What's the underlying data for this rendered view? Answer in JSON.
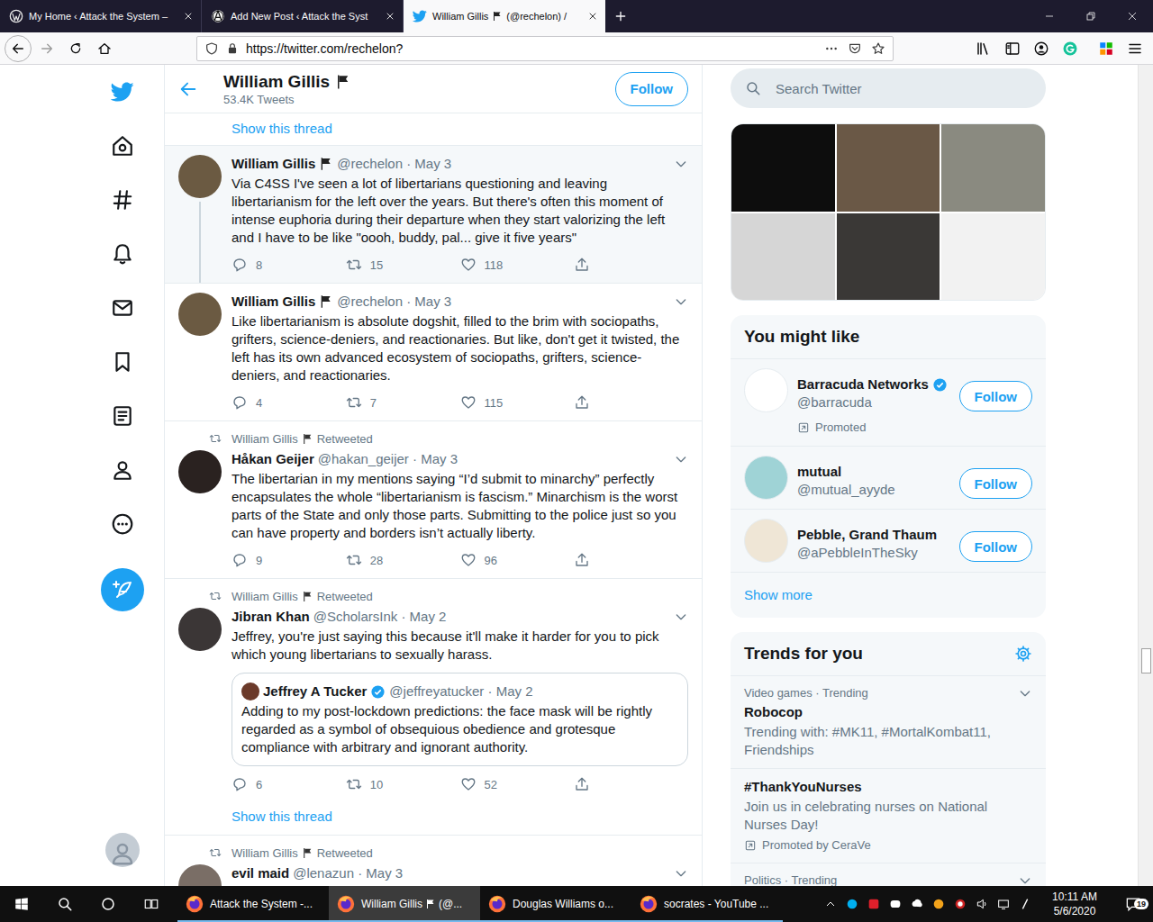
{
  "browser": {
    "tabs": [
      {
        "label": "My Home ‹ Attack the System –",
        "kind": "wordpress",
        "selected": false
      },
      {
        "label": "Add New Post ‹ Attack the Syst",
        "kind": "anarchy",
        "selected": false
      },
      {
        "label": "William Gillis",
        "label_after_flag": "(@rechelon) /",
        "kind": "twitter",
        "selected": true
      }
    ],
    "url": "https://twitter.com/rechelon?"
  },
  "profile": {
    "name": "William Gillis",
    "flag": true,
    "tweet_count": "53.4K Tweets",
    "follow_button": "Follow"
  },
  "top_link": "Show this thread",
  "tweets": [
    {
      "retweeted_by": null,
      "name": "William Gillis",
      "flag": true,
      "verified": false,
      "meta": "@rechelon · May 3",
      "text": "Via C4SS I've seen a lot of libertarians questioning and leaving libertarianism for the left over the years. But there's often this moment of intense euphoria during their departure when they start valorizing the left and I have to be like \"oooh, buddy, pal... give it five years\"",
      "highlighted": true,
      "thread_line": true,
      "color": "#6b5a42",
      "quote": null,
      "counts": {
        "replies": "8",
        "retweets": "15",
        "likes": "118"
      },
      "show_thread": null
    },
    {
      "retweeted_by": null,
      "name": "William Gillis",
      "flag": true,
      "verified": false,
      "meta": "@rechelon · May 3",
      "text": "Like libertarianism is absolute dogshit, filled to the brim with sociopaths, grifters, science-deniers, and reactionaries. But like, don't get it twisted, the left has its own advanced ecosystem of sociopaths, grifters, science-deniers, and reactionaries.",
      "highlighted": false,
      "thread_line": false,
      "color": "#6b5a42",
      "quote": null,
      "counts": {
        "replies": "4",
        "retweets": "7",
        "likes": "115"
      },
      "show_thread": null
    },
    {
      "retweeted_by": {
        "name": "William Gillis",
        "flag": true,
        "label": "Retweeted"
      },
      "name": "Håkan Geijer",
      "flag": false,
      "verified": false,
      "meta": "@hakan_geijer · May 3",
      "text": "The libertarian in my mentions saying “I’d submit to minarchy” perfectly encapsulates the whole “libertarianism is fascism.” Minarchism is the worst parts of the State and only those parts. Submitting to the police just so you can have property and borders isn’t actually liberty.",
      "highlighted": false,
      "thread_line": false,
      "color": "#2a2220",
      "quote": null,
      "counts": {
        "replies": "9",
        "retweets": "28",
        "likes": "96"
      },
      "show_thread": null
    },
    {
      "retweeted_by": {
        "name": "William Gillis",
        "flag": true,
        "label": "Retweeted"
      },
      "name": "Jibran Khan",
      "flag": false,
      "verified": false,
      "meta": "@ScholarsInk · May 2",
      "text": "Jeffrey, you're just saying this because it'll make it harder for you to pick which young libertarians to sexually harass.",
      "highlighted": false,
      "thread_line": false,
      "color": "#3b3636",
      "quote": {
        "name": "Jeffrey A Tucker",
        "verified": true,
        "meta": "@jeffreyatucker · May 2",
        "color": "#6b3a2a",
        "text": "Adding to my post-lockdown predictions: the face mask will be rightly regarded as a symbol of obsequious obedience and grotesque compliance with arbitrary and ignorant authority."
      },
      "counts": {
        "replies": "6",
        "retweets": "10",
        "likes": "52"
      },
      "show_thread": "Show this thread"
    },
    {
      "retweeted_by": {
        "name": "William Gillis",
        "flag": true,
        "label": "Retweeted"
      },
      "name": "evil maid",
      "flag": false,
      "verified": false,
      "meta": "@lenazun · May 3",
      "text": null,
      "highlighted": false,
      "thread_line": false,
      "color": "#7a6e66",
      "quote": null,
      "counts": null,
      "show_thread": null
    }
  ],
  "sidebar": {
    "search": {
      "placeholder": "Search Twitter"
    },
    "media": [
      {
        "color": "#0d0d0d"
      },
      {
        "color": "#6a5846"
      },
      {
        "color": "#8a8a80"
      },
      {
        "color": "#d6d6d6"
      },
      {
        "color": "#3a3836"
      },
      {
        "color": "#f2f2f2"
      }
    ],
    "who_to_follow": {
      "title": "You might like",
      "users": [
        {
          "name": "Barracuda Networks",
          "verified": true,
          "handle": "@barracuda",
          "promoted": "Promoted",
          "button": "Follow",
          "color": "#ffffff"
        },
        {
          "name": "mutual",
          "verified": false,
          "handle": "@mutual_ayyde",
          "promoted": null,
          "button": "Follow",
          "color": "#9fd3d6"
        },
        {
          "name": "Pebble, Grand Thaum",
          "verified": false,
          "handle": "@aPebbleInTheSky",
          "promoted": null,
          "button": "Follow",
          "color": "#efe6d6"
        }
      ],
      "show_more": "Show more"
    },
    "trends": {
      "title": "Trends for you",
      "items": [
        {
          "context": "Video games · Trending",
          "name": "Robocop",
          "detail": "Trending with: #MK11, #MortalKombat11, Friendships",
          "promoted": null
        },
        {
          "context": null,
          "name": "#ThankYouNurses",
          "detail": "Join us in celebrating nurses on National Nurses Day!",
          "promoted": "Promoted by CeraVe"
        },
        {
          "context": "Politics · Trending",
          "name": null,
          "detail": null,
          "promoted": null
        }
      ]
    }
  },
  "taskbar": {
    "apps": [
      {
        "label": "Attack the System -...",
        "selected": false
      },
      {
        "label": "William Gillis",
        "label_after_flag": "(@...",
        "selected": true
      },
      {
        "label": "Douglas Williams o...",
        "selected": false
      },
      {
        "label": "socrates - YouTube ...",
        "selected": false
      }
    ],
    "time": "10:11 AM",
    "date": "5/6/2020",
    "notifications": "19"
  }
}
